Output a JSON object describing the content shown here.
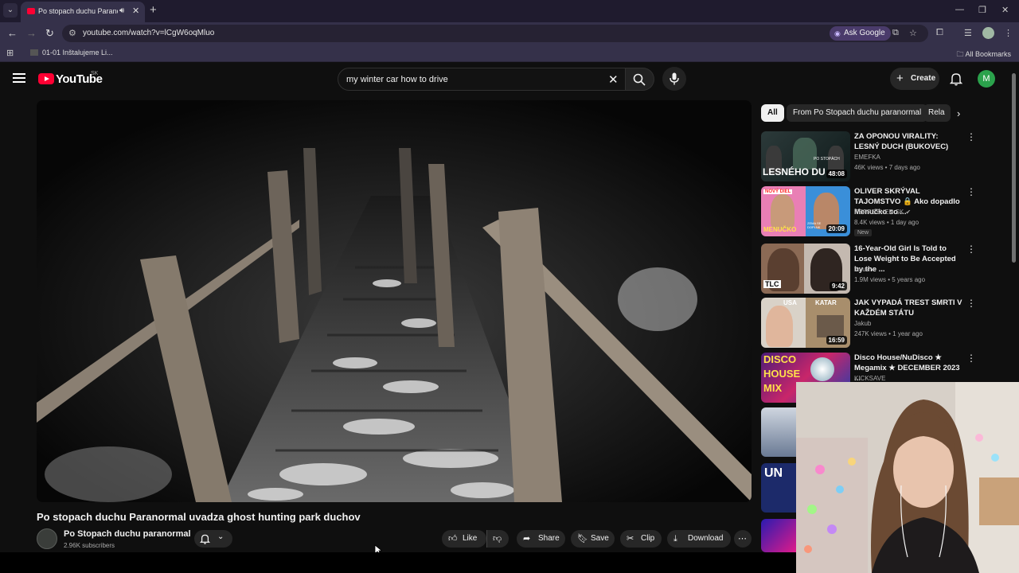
{
  "browser": {
    "tab_title": "Po stopach duchu Paranormal uvadza ghost hunting park duchov",
    "url": "youtube.com/watch?v=lCgW6oqMluo",
    "ask_google": "Ask Google",
    "bookmark_item": "01-01 Inštalujeme Li...",
    "all_bookmarks": "All Bookmarks"
  },
  "masthead": {
    "logo": "YouTube",
    "region": "SK",
    "search_query": "my winter car how to drive",
    "create_label": "Create",
    "avatar_letter": "M"
  },
  "video": {
    "title": "Po stopach duchu Paranormal uvadza ghost hunting park duchov",
    "channel": "Po Stopach duchu paranormal",
    "subscribers": "2.96K subscribers",
    "like_label": "Like",
    "share_label": "Share",
    "save_label": "Save",
    "clip_label": "Clip",
    "download_label": "Download"
  },
  "chips": [
    "All",
    "From Po Stopach duchu paranormal",
    "Rela"
  ],
  "recommendations": [
    {
      "title": "ZA OPONOU VIRALITY: LESNÝ DUCH (BUKOVEC)",
      "channel": "EMEFKA",
      "meta": "46K views • 7 days ago",
      "duration": "48:08",
      "verified": false,
      "badge": ""
    },
    {
      "title": "OLIVER SKRÝVAL TAJOMSTVO 🔒 Ako dopadlo Menučko so ...",
      "channel": "REFRESHER SK",
      "meta": "8.4K views • 1 day ago",
      "duration": "20:09",
      "verified": true,
      "badge": "New"
    },
    {
      "title": "16-Year-Old Girl Is Told to Lose Weight to Be Accepted by the ...",
      "channel": "tlc uk",
      "meta": "1.9M views • 5 years ago",
      "duration": "9:42",
      "verified": true,
      "badge": ""
    },
    {
      "title": "JAK VYPADÁ TREST SMRTI V KAŽDÉM STÁTU",
      "channel": "Jakub",
      "meta": "247K views • 1 year ago",
      "duration": "16:59",
      "verified": false,
      "badge": ""
    },
    {
      "title": "Disco House/NuDisco ★ Megamix ★ DECEMBER 2023 ...",
      "channel": "KICKSAVE",
      "meta": "",
      "duration": "",
      "verified": false,
      "badge": ""
    }
  ],
  "thumb_text": {
    "t1_line": "LESNÉHO DU",
    "t1_small": "PO STOPÁCH",
    "t2_top": "NOVÝ DIEL",
    "t2_bottom": "MENUČKO",
    "t2_corner": "ZEMA SE DOPLNK",
    "t3_logo": "TLC",
    "t4_left": "USA",
    "t4_right": "KATAR",
    "t5_line1": "DISCO",
    "t5_line2": "HOUSE",
    "t5_line3": "MIX",
    "t7_text": "UN"
  },
  "colors": {
    "yt_red": "#ff0033",
    "page_bg": "#0f0f0f",
    "chip_bg": "#272727",
    "browser_frame": "#35314a"
  }
}
